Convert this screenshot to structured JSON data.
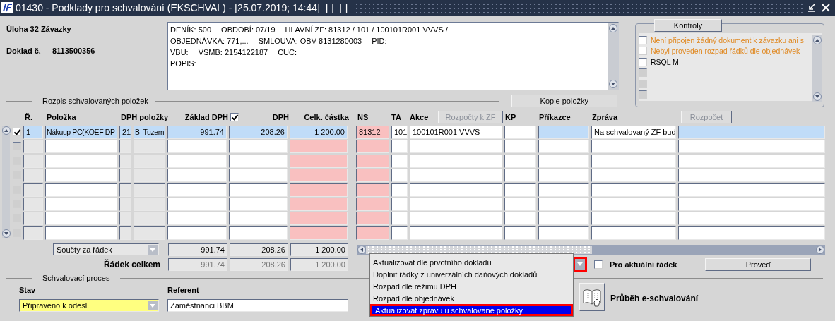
{
  "window": {
    "title": "01430 - Podklady pro schvalování (EKSCHVAL) - [25.07.2019; 14:44]",
    "title_extras": [
      "[ ]",
      "[ ]"
    ]
  },
  "header": {
    "task": "Úloha 32 Závazky",
    "doc_label": "Doklad č.",
    "doc_number": "8113500356"
  },
  "info_lines": [
    [
      "DENÍK: 500",
      "OBDOBÍ: 07/19",
      "HLAVNÍ ZF: 81312 / 101 / 100101R001 VVVS /"
    ],
    [
      "OBJEDNÁVKA: 771,...",
      "SMLOUVA: OBV-8131280003",
      "PID:"
    ],
    [
      "VBU:",
      "VSMB: 2154122187",
      "CUC:"
    ],
    [
      "POPIS:"
    ]
  ],
  "checks": {
    "button": "Kontroly",
    "items": [
      {
        "kind": "warning",
        "text": "Není připojen žádný dokument k závazku ani s",
        "checked": false
      },
      {
        "kind": "warning",
        "text": "Nebyl proveden rozpad řádků dle objednávek",
        "checked": false
      },
      {
        "kind": "normal",
        "text": "RSQL M",
        "checked": false
      },
      {
        "kind": "empty",
        "checked": false
      },
      {
        "kind": "empty",
        "checked": false
      },
      {
        "kind": "empty",
        "checked": false
      }
    ]
  },
  "items_section": {
    "title": "Rozpis schvalovaných položek",
    "copy_button": "Kopie položky"
  },
  "table": {
    "header": [
      {
        "kind": "label",
        "text": "Ř."
      },
      {
        "kind": "label",
        "text": "Položka"
      },
      {
        "kind": "label",
        "text": "DPH položky"
      },
      {
        "kind": "label",
        "text": "Základ DPH"
      },
      {
        "kind": "checkbox",
        "checked": true
      },
      {
        "kind": "label",
        "text": "DPH"
      },
      {
        "kind": "label",
        "text": "Celk. částka"
      },
      {
        "kind": "label",
        "text": "NS"
      },
      {
        "kind": "label",
        "text": "TA"
      },
      {
        "kind": "label",
        "text": "Akce"
      },
      {
        "kind": "button",
        "text": "Rozpočty k ZF",
        "disabled": true
      },
      {
        "kind": "label",
        "text": "KP"
      },
      {
        "kind": "label",
        "text": "Příkazce"
      },
      {
        "kind": "label",
        "text": "Zpráva"
      },
      {
        "kind": "button",
        "text": "Rozpočet",
        "disabled": true
      }
    ],
    "rows": [
      {
        "checked": true,
        "current": true,
        "cells": {
          "r": "1",
          "polozka": "Nákuup PC(KOEF DP",
          "dph_sazba": "21",
          "dph_typ": "B  Tuzem",
          "zaklad_dph": "991.74",
          "dph": "208.26",
          "celk_castka": "1 200.00",
          "ns": "81312",
          "ta": "101",
          "akce": "100101R001 VVVS",
          "zprava": "Na schvalovaný ZF bud"
        }
      },
      {
        "checked": false,
        "current": false,
        "cells": {}
      },
      {
        "checked": false,
        "current": false,
        "cells": {}
      },
      {
        "checked": false,
        "current": false,
        "cells": {}
      },
      {
        "checked": false,
        "current": false,
        "cells": {}
      },
      {
        "checked": false,
        "current": false,
        "cells": {}
      },
      {
        "checked": false,
        "current": false,
        "cells": {}
      },
      {
        "checked": false,
        "current": false,
        "cells": {}
      }
    ]
  },
  "totals": {
    "mode_select": "Součty za řádek",
    "sums": [
      "991.74",
      "208.26",
      "1 200.00"
    ],
    "row_total_label": "Řádek celkem",
    "row_totals": [
      "991.74",
      "208.26",
      "1 200.00"
    ]
  },
  "actions": {
    "arrow_highlighted": true,
    "options": [
      {
        "label": "Aktualizovat dle prvotního dokladu",
        "selected": false,
        "highlighted": false
      },
      {
        "label": "Doplnit řádky z univerzálních daňových dokladů",
        "selected": false,
        "highlighted": false
      },
      {
        "label": "Rozpad dle režimu DPH",
        "selected": false,
        "highlighted": false
      },
      {
        "label": "Rozpad dle objednávek",
        "selected": false,
        "highlighted": false
      },
      {
        "label": "Aktualizovat zprávu u schvalované položky",
        "selected": true,
        "highlighted": true
      }
    ],
    "current_row": {
      "label": "Pro aktuální řádek",
      "checked": false
    },
    "run_button": "Proveď"
  },
  "approval": {
    "title": "Schvalovací proces",
    "state_label": "Stav",
    "state_value": "Připraveno k odesl.",
    "referent_label": "Referent",
    "referent_value": "Zaměstnanci BBM",
    "history_button": "Průběh e-schvalování"
  }
}
